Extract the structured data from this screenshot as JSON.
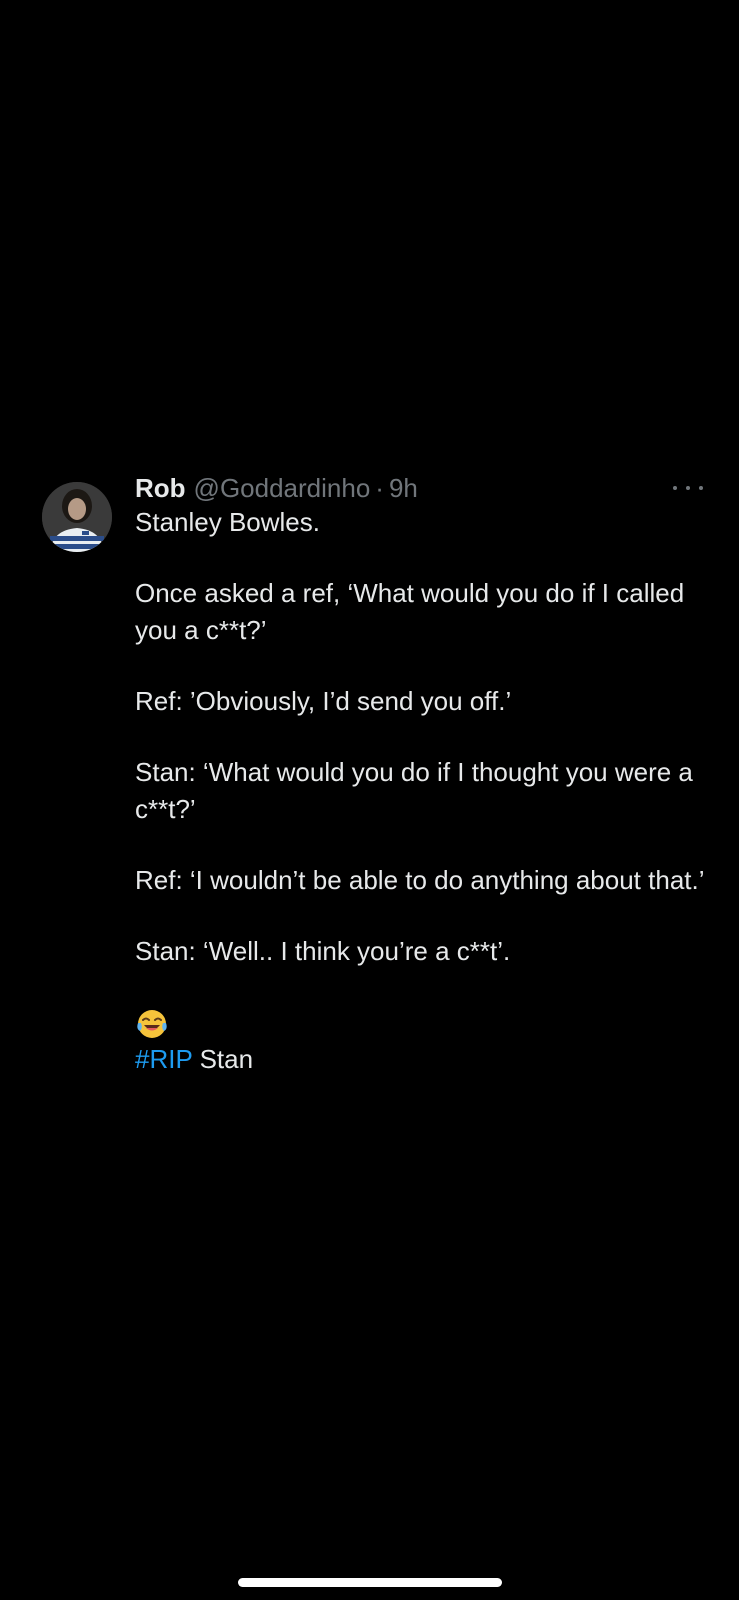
{
  "tweet": {
    "author": {
      "display_name": "Rob",
      "handle": "@Goddardinho",
      "separator": "·",
      "time": "9h",
      "avatar_icon": "avatar-photo"
    },
    "more_icon": "more-options-icon",
    "text": {
      "line1": "Stanley Bowles.",
      "line2": "Once asked a ref, ‘What would you do if I called you a c**t?’",
      "line3": "Ref: ’Obviously, I’d send you off.’",
      "line4": "Stan: ‘What would you do if I thought you were a c**t?’",
      "line5": "Ref: ‘I wouldn’t be able to do anything about that.’",
      "line6": "Stan: ‘Well.. I think you’re a c**t’.",
      "emoji": "😂",
      "hashtag": "#RIP",
      "closing": " Stan"
    }
  },
  "colors": {
    "background": "#000000",
    "text": "#e7e9ea",
    "muted": "#71767b",
    "link": "#1d9bf0"
  }
}
